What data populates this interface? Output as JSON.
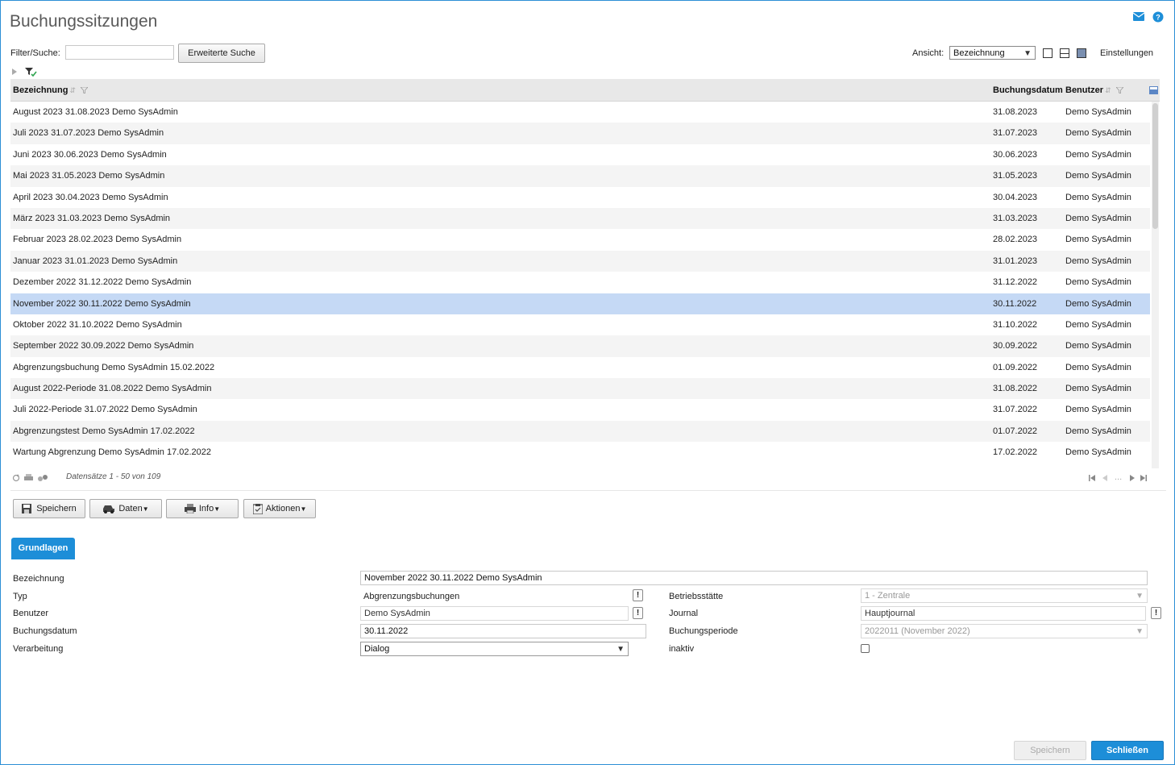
{
  "page": {
    "title": "Buchungssitzungen"
  },
  "filter": {
    "label": "Filter/Suche:",
    "value": "",
    "advanced_button": "Erweiterte Suche",
    "view_label": "Ansicht:",
    "view_value": "Bezeichnung",
    "settings": "Einstellungen"
  },
  "grid": {
    "headers": {
      "name": "Bezeichnung",
      "date": "Buchungsdatum",
      "user": "Benutzer"
    },
    "rows": [
      {
        "name": "August 2023 31.08.2023 Demo SysAdmin",
        "date": "31.08.2023",
        "user": "Demo SysAdmin"
      },
      {
        "name": "Juli 2023 31.07.2023 Demo SysAdmin",
        "date": "31.07.2023",
        "user": "Demo SysAdmin"
      },
      {
        "name": "Juni 2023 30.06.2023 Demo SysAdmin",
        "date": "30.06.2023",
        "user": "Demo SysAdmin"
      },
      {
        "name": "Mai 2023 31.05.2023 Demo SysAdmin",
        "date": "31.05.2023",
        "user": "Demo SysAdmin"
      },
      {
        "name": "April 2023 30.04.2023 Demo SysAdmin",
        "date": "30.04.2023",
        "user": "Demo SysAdmin"
      },
      {
        "name": "März 2023 31.03.2023 Demo SysAdmin",
        "date": "31.03.2023",
        "user": "Demo SysAdmin"
      },
      {
        "name": "Februar 2023 28.02.2023 Demo SysAdmin",
        "date": "28.02.2023",
        "user": "Demo SysAdmin"
      },
      {
        "name": "Januar 2023 31.01.2023 Demo SysAdmin",
        "date": "31.01.2023",
        "user": "Demo SysAdmin"
      },
      {
        "name": "Dezember 2022 31.12.2022 Demo SysAdmin",
        "date": "31.12.2022",
        "user": "Demo SysAdmin"
      },
      {
        "name": "November 2022 30.11.2022 Demo SysAdmin",
        "date": "30.11.2022",
        "user": "Demo SysAdmin"
      },
      {
        "name": "Oktober 2022 31.10.2022 Demo SysAdmin",
        "date": "31.10.2022",
        "user": "Demo SysAdmin"
      },
      {
        "name": "September 2022 30.09.2022 Demo SysAdmin",
        "date": "30.09.2022",
        "user": "Demo SysAdmin"
      },
      {
        "name": "Abgrenzungsbuchung Demo SysAdmin 15.02.2022",
        "date": "01.09.2022",
        "user": "Demo SysAdmin"
      },
      {
        "name": "August 2022-Periode 31.08.2022 Demo SysAdmin",
        "date": "31.08.2022",
        "user": "Demo SysAdmin"
      },
      {
        "name": "Juli 2022-Periode 31.07.2022 Demo SysAdmin",
        "date": "31.07.2022",
        "user": "Demo SysAdmin"
      },
      {
        "name": "Abgrenzungstest Demo SysAdmin 17.02.2022",
        "date": "01.07.2022",
        "user": "Demo SysAdmin"
      },
      {
        "name": "Wartung Abgrenzung Demo SysAdmin 17.02.2022",
        "date": "17.02.2022",
        "user": "Demo SysAdmin"
      }
    ],
    "selected_row": 9,
    "pager_text": "Datensätze 1 - 50 von 109",
    "pager_ellipsis": "..."
  },
  "toolbar": {
    "save": "Speichern",
    "data": "Daten",
    "info": "Info",
    "actions": "Aktionen"
  },
  "tabs": {
    "basics": "Grundlagen"
  },
  "form": {
    "bezeichnung_label": "Bezeichnung",
    "bezeichnung_value": "November 2022 30.11.2022 Demo SysAdmin",
    "typ_label": "Typ",
    "typ_value": "Abgrenzungsbuchungen",
    "benutzer_label": "Benutzer",
    "benutzer_value": "Demo SysAdmin",
    "buchungsdatum_label": "Buchungsdatum",
    "buchungsdatum_value": "30.11.2022",
    "verarbeitung_label": "Verarbeitung",
    "verarbeitung_value": "Dialog",
    "betriebsstaette_label": "Betriebsstätte",
    "betriebsstaette_value": "1 - Zentrale",
    "journal_label": "Journal",
    "journal_value": "Hauptjournal",
    "buchungsperiode_label": "Buchungsperiode",
    "buchungsperiode_value": "2022011 (November 2022)",
    "inaktiv_label": "inaktiv",
    "inaktiv_checked": false,
    "exclam": "!"
  },
  "footer": {
    "save": "Speichern",
    "close": "Schließen"
  },
  "colors": {
    "accent": "#1d8ed8",
    "selected_row": "#c5d9f5",
    "frame": "#2b8fd6"
  }
}
